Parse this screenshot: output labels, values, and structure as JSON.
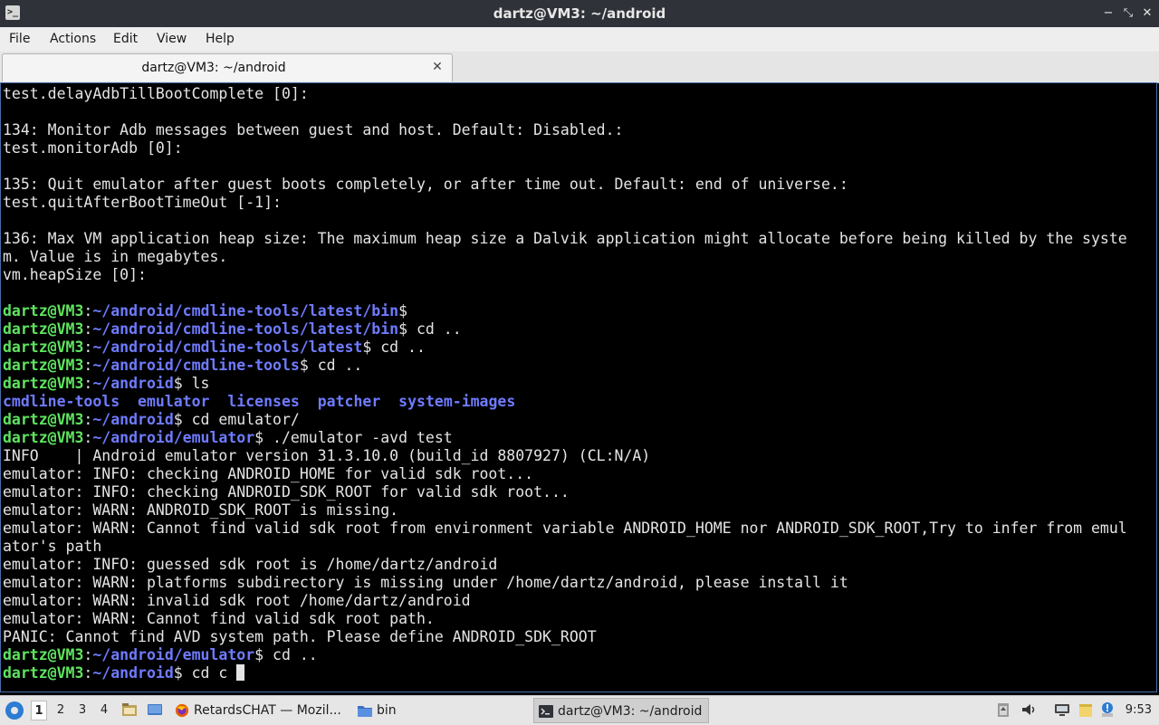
{
  "window": {
    "title": "dartz@VM3: ~/android",
    "app_icon_glyph": ">_",
    "minimize_glyph": "−",
    "maximize_glyph": "⤡",
    "close_glyph": "✕"
  },
  "menu": [
    "File",
    "Actions",
    "Edit",
    "View",
    "Help"
  ],
  "tab": {
    "label": "dartz@VM3: ~/android",
    "close_glyph": "✕"
  },
  "prompt": {
    "user": "dartz@VM3",
    "sep": ":"
  },
  "terminal": {
    "head_lines": [
      "test.delayAdbTillBootComplete [0]:",
      "",
      "134: Monitor Adb messages between guest and host. Default: Disabled.:",
      "test.monitorAdb [0]:",
      "",
      "135: Quit emulator after guest boots completely, or after time out. Default: end of universe.:",
      "test.quitAfterBootTimeOut [-1]:",
      "",
      "136: Max VM application heap size: The maximum heap size a Dalvik application might allocate before being killed by the syste",
      "m. Value is in megabytes.",
      "vm.heapSize [0]:",
      ""
    ],
    "cmd1": {
      "path": "~/android/cmdline-tools/latest/bin",
      "cmd": "$"
    },
    "cmd2": {
      "path": "~/android/cmdline-tools/latest/bin",
      "cmd": "$ cd .."
    },
    "cmd3": {
      "path": "~/android/cmdline-tools/latest",
      "cmd": "$ cd .."
    },
    "cmd4": {
      "path": "~/android/cmdline-tools",
      "cmd": "$ cd .."
    },
    "cmd5": {
      "path": "~/android",
      "cmd": "$ ls"
    },
    "ls_dirs": [
      "cmdline-tools",
      "emulator",
      "licenses",
      "patcher",
      "system-images"
    ],
    "cmd6": {
      "path": "~/android",
      "cmd": "$ cd emulator/"
    },
    "cmd7": {
      "path": "~/android/emulator",
      "cmd": "$ ./emulator -avd test"
    },
    "emulator_output": [
      "INFO    | Android emulator version 31.3.10.0 (build_id 8807927) (CL:N/A)",
      "emulator: INFO: checking ANDROID_HOME for valid sdk root...",
      "emulator: INFO: checking ANDROID_SDK_ROOT for valid sdk root...",
      "emulator: WARN: ANDROID_SDK_ROOT is missing.",
      "emulator: WARN: Cannot find valid sdk root from environment variable ANDROID_HOME nor ANDROID_SDK_ROOT,Try to infer from emul",
      "ator's path",
      "emulator: INFO: guessed sdk root is /home/dartz/android",
      "emulator: WARN: platforms subdirectory is missing under /home/dartz/android, please install it",
      "emulator: WARN: invalid sdk root /home/dartz/android",
      "emulator: WARN: Cannot find valid sdk root path.",
      "PANIC: Cannot find AVD system path. Please define ANDROID_SDK_ROOT"
    ],
    "cmd8": {
      "path": "~/android/emulator",
      "cmd": "$ cd .."
    },
    "cmd9": {
      "path": "~/android",
      "cmd": "$ cd c "
    }
  },
  "taskbar": {
    "workspaces": [
      "1",
      "2",
      "3",
      "4"
    ],
    "tasks": [
      {
        "label": "RetardsCHAT — Mozil..."
      },
      {
        "label": "bin"
      },
      {
        "label": "dartz@VM3: ~/android"
      }
    ],
    "clock": "9:53"
  },
  "colors": {
    "prompt_user": "#5fe45f",
    "prompt_path": "#6f7bff",
    "taskbar_bg": "#e6e6e6",
    "titlebar_bg": "#2f3238"
  }
}
